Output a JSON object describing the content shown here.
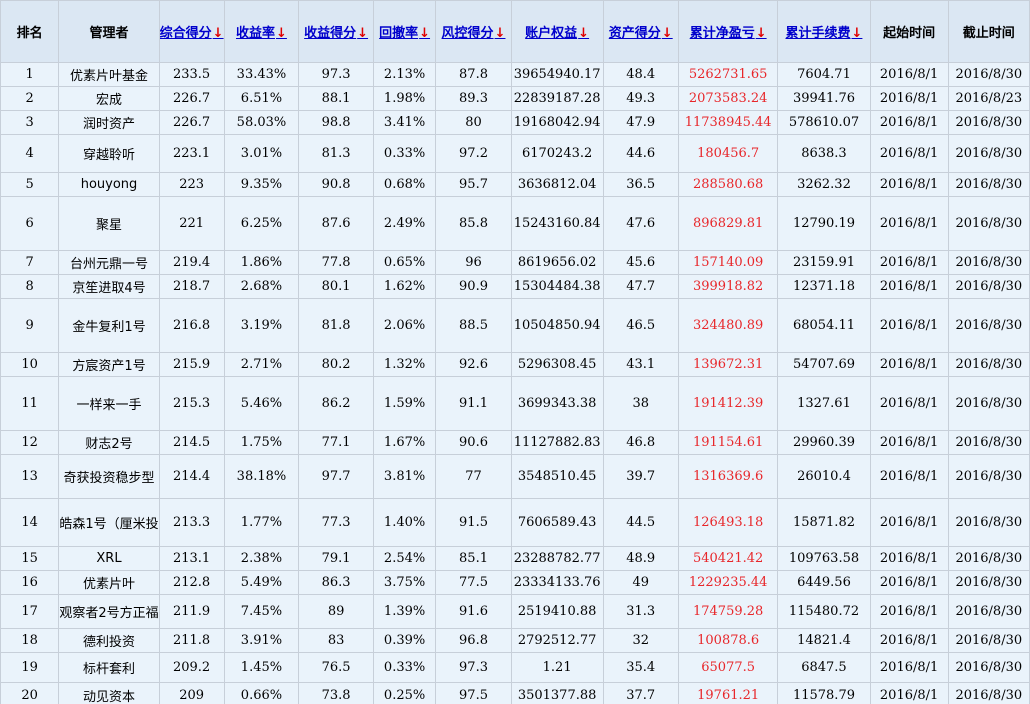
{
  "colors": {
    "header_bg": "#dbe7f3",
    "cell_bg": "#eaf3fb",
    "link": "#0000cc",
    "arrow": "#e00000",
    "negative": "#e8262a",
    "grid": "#c7cfd9"
  },
  "icons": {
    "sort_indicator": "down-arrow-icon"
  },
  "headers": [
    {
      "label": "排名",
      "link": false,
      "arrow": false
    },
    {
      "label": "管理者",
      "link": false,
      "arrow": false
    },
    {
      "label": "综合得分",
      "link": true,
      "arrow": true
    },
    {
      "label": "收益率",
      "link": true,
      "arrow": true
    },
    {
      "label": "收益得分",
      "link": true,
      "arrow": true
    },
    {
      "label": "回撤率",
      "link": true,
      "arrow": true
    },
    {
      "label": "风控得分",
      "link": true,
      "arrow": true
    },
    {
      "label": "账户权益",
      "link": true,
      "arrow": true
    },
    {
      "label": "资产得分",
      "link": true,
      "arrow": true
    },
    {
      "label": "累计净盈亏",
      "link": true,
      "arrow": true
    },
    {
      "label": "累计手续费",
      "link": true,
      "arrow": true
    },
    {
      "label": "起始时间",
      "link": false,
      "arrow": false
    },
    {
      "label": "截止时间",
      "link": false,
      "arrow": false
    }
  ],
  "rows": [
    [
      "1",
      "优素片叶基金",
      "233.5",
      "33.43%",
      "97.3",
      "2.13%",
      "87.8",
      "39654940.17",
      "48.4",
      "5262731.65",
      "7604.71",
      "2016/8/1",
      "2016/8/30"
    ],
    [
      "2",
      "宏成",
      "226.7",
      "6.51%",
      "88.1",
      "1.98%",
      "89.3",
      "22839187.28",
      "49.3",
      "2073583.24",
      "39941.76",
      "2016/8/1",
      "2016/8/23"
    ],
    [
      "3",
      "润时资产",
      "226.7",
      "58.03%",
      "98.8",
      "3.41%",
      "80",
      "19168042.94",
      "47.9",
      "11738945.44",
      "578610.07",
      "2016/8/1",
      "2016/8/30"
    ],
    [
      "4",
      "穿越聆听",
      "223.1",
      "3.01%",
      "81.3",
      "0.33%",
      "97.2",
      "6170243.2",
      "44.6",
      "180456.7",
      "8638.3",
      "2016/8/1",
      "2016/8/30"
    ],
    [
      "5",
      "houyong",
      "223",
      "9.35%",
      "90.8",
      "0.68%",
      "95.7",
      "3636812.04",
      "36.5",
      "288580.68",
      "3262.32",
      "2016/8/1",
      "2016/8/30"
    ],
    [
      "6",
      "聚星",
      "221",
      "6.25%",
      "87.6",
      "2.49%",
      "85.8",
      "15243160.84",
      "47.6",
      "896829.81",
      "12790.19",
      "2016/8/1",
      "2016/8/30"
    ],
    [
      "7",
      "台州元鼎一号",
      "219.4",
      "1.86%",
      "77.8",
      "0.65%",
      "96",
      "8619656.02",
      "45.6",
      "157140.09",
      "23159.91",
      "2016/8/1",
      "2016/8/30"
    ],
    [
      "8",
      "京笙进取4号",
      "218.7",
      "2.68%",
      "80.1",
      "1.62%",
      "90.9",
      "15304484.38",
      "47.7",
      "399918.82",
      "12371.18",
      "2016/8/1",
      "2016/8/30"
    ],
    [
      "9",
      "金牛复利1号",
      "216.8",
      "3.19%",
      "81.8",
      "2.06%",
      "88.5",
      "10504850.94",
      "46.5",
      "324480.89",
      "68054.11",
      "2016/8/1",
      "2016/8/30"
    ],
    [
      "10",
      "方宸资产1号",
      "215.9",
      "2.71%",
      "80.2",
      "1.32%",
      "92.6",
      "5296308.45",
      "43.1",
      "139672.31",
      "54707.69",
      "2016/8/1",
      "2016/8/30"
    ],
    [
      "11",
      "一样来一手",
      "215.3",
      "5.46%",
      "86.2",
      "1.59%",
      "91.1",
      "3699343.38",
      "38",
      "191412.39",
      "1327.61",
      "2016/8/1",
      "2016/8/30"
    ],
    [
      "12",
      "财志2号",
      "214.5",
      "1.75%",
      "77.1",
      "1.67%",
      "90.6",
      "11127882.83",
      "46.8",
      "191154.61",
      "29960.39",
      "2016/8/1",
      "2016/8/30"
    ],
    [
      "13",
      "奇获投资稳步型",
      "214.4",
      "38.18%",
      "97.7",
      "3.81%",
      "77",
      "3548510.45",
      "39.7",
      "1316369.6",
      "26010.4",
      "2016/8/1",
      "2016/8/30"
    ],
    [
      "14",
      "皓森1号（厘米投",
      "213.3",
      "1.77%",
      "77.3",
      "1.40%",
      "91.5",
      "7606589.43",
      "44.5",
      "126493.18",
      "15871.82",
      "2016/8/1",
      "2016/8/30"
    ],
    [
      "15",
      "XRL",
      "213.1",
      "2.38%",
      "79.1",
      "2.54%",
      "85.1",
      "23288782.77",
      "48.9",
      "540421.42",
      "109763.58",
      "2016/8/1",
      "2016/8/30"
    ],
    [
      "16",
      "优素片叶",
      "212.8",
      "5.49%",
      "86.3",
      "3.75%",
      "77.5",
      "23334133.76",
      "49",
      "1229235.44",
      "6449.56",
      "2016/8/1",
      "2016/8/30"
    ],
    [
      "17",
      "观察者2号方正福",
      "211.9",
      "7.45%",
      "89",
      "1.39%",
      "91.6",
      "2519410.88",
      "31.3",
      "174759.28",
      "115480.72",
      "2016/8/1",
      "2016/8/30"
    ],
    [
      "18",
      "德利投资",
      "211.8",
      "3.91%",
      "83",
      "0.39%",
      "96.8",
      "2792512.77",
      "32",
      "100878.6",
      "14821.4",
      "2016/8/1",
      "2016/8/30"
    ],
    [
      "19",
      "标杆套利",
      "209.2",
      "1.45%",
      "76.5",
      "0.33%",
      "97.3",
      "1.21",
      "35.4",
      "65077.5",
      "6847.5",
      "2016/8/1",
      "2016/8/30"
    ],
    [
      "20",
      "动见资本",
      "209",
      "0.66%",
      "73.8",
      "0.25%",
      "97.5",
      "3501377.88",
      "37.7",
      "19761.21",
      "11578.79",
      "2016/8/1",
      "2016/8/30"
    ]
  ]
}
